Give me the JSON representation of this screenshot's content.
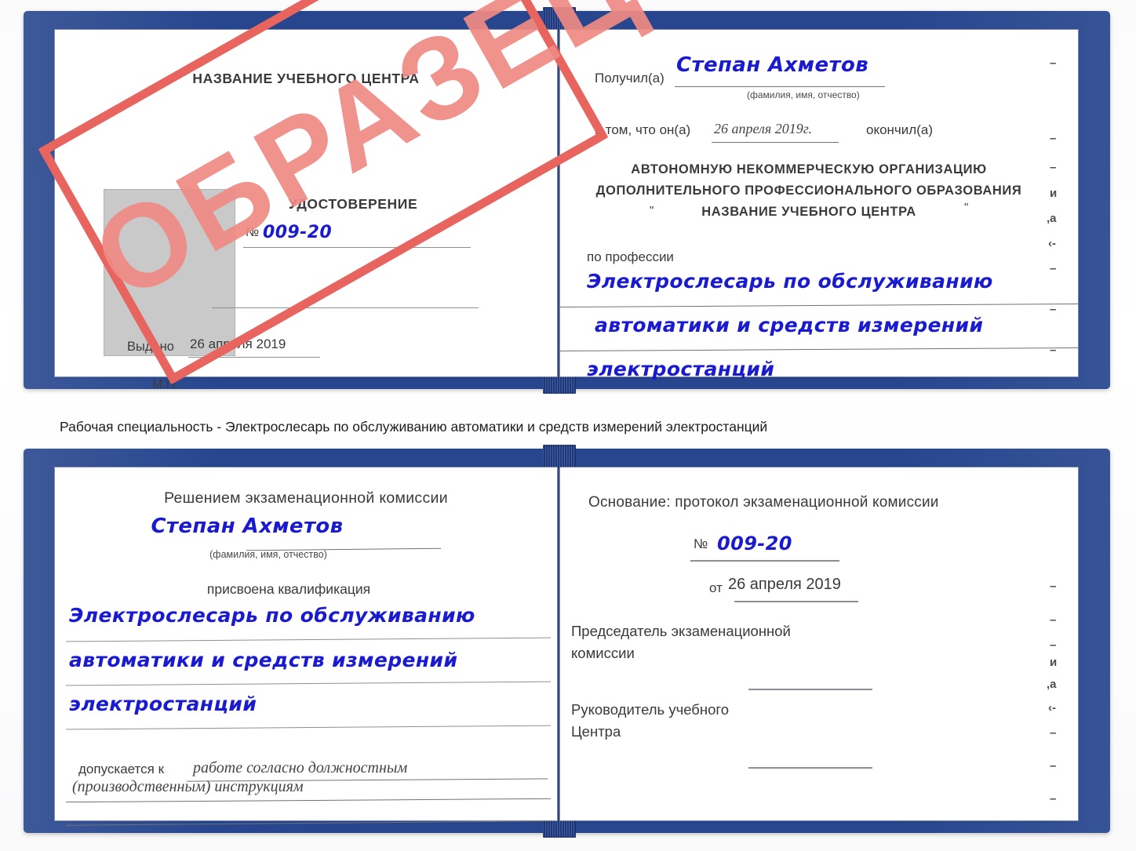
{
  "caption": {
    "text": "Рабочая специальность - Электрослесарь по обслуживанию автоматики и средств измерений электростанций"
  },
  "stamp": {
    "label": "ОБРАЗЕЦ",
    "color": "#f08a84",
    "border_color": "#e8645e"
  },
  "certificate_top": {
    "left_page": {
      "org_title": "НАЗВАНИЕ УЧЕБНОГО ЦЕНТРА",
      "doc_title": "УДОСТОВЕРЕНИЕ",
      "number_label": "№",
      "number_value": "009-20",
      "issued_label": "Выдано",
      "issued_value": "26 апреля 2019",
      "seal_label": "М.П.",
      "photo_placeholder": "photo-placeholder"
    },
    "right_page": {
      "received_label": "Получил(а)",
      "received_value": "Степан Ахметов",
      "received_hint": "(фамилия, имя, отчество)",
      "that_he_label": "в том, что он(а)",
      "that_he_value": "26 апреля 2019г.",
      "finished_label": "окончил(а)",
      "org_line1": "АВТОНОМНУЮ НЕКОММЕРЧЕСКУЮ ОРГАНИЗАЦИЮ",
      "org_line2": "ДОПОЛНИТЕЛЬНОГО ПРОФЕССИОНАЛЬНОГО ОБРАЗОВАНИЯ",
      "org_quote_open": "\"",
      "org_line3": "НАЗВАНИЕ УЧЕБНОГО ЦЕНТРА",
      "org_quote_close": "\"",
      "profession_label": "по профессии",
      "profession_line1": "Электрослесарь по обслуживанию",
      "profession_line2": "автоматики и средств измерений",
      "profession_line3": "электростанций",
      "edge_marks": [
        "–",
        "–",
        "–",
        "и",
        ",а",
        "‹-",
        "–",
        "–",
        "–"
      ]
    }
  },
  "certificate_bottom": {
    "left_page": {
      "decision_title": "Решением экзаменационной комиссии",
      "name_value": "Степан Ахметов",
      "name_hint": "(фамилия, имя, отчество)",
      "qualification_label": "присвоена квалификация",
      "qualification_line1": "Электрослесарь по обслуживанию",
      "qualification_line2": "автоматики и средств измерений",
      "qualification_line3": "электростанций",
      "allowed_label": "допускается к",
      "allowed_value_line1": "работе согласно должностным",
      "allowed_value_line2": "(производственным) инструкциям"
    },
    "right_page": {
      "basis_label": "Основание: протокол экзаменационной комиссии",
      "number_label": "№",
      "number_value": "009-20",
      "date_label": "от",
      "date_value": "26 апреля 2019",
      "chairman_line1": "Председатель экзаменационной",
      "chairman_line2": "комиссии",
      "head_line1": "Руководитель учебного",
      "head_line2": "Центра",
      "edge_marks": [
        "–",
        "–",
        "–",
        "и",
        ",а",
        "‹-",
        "–",
        "–",
        "–"
      ]
    }
  }
}
